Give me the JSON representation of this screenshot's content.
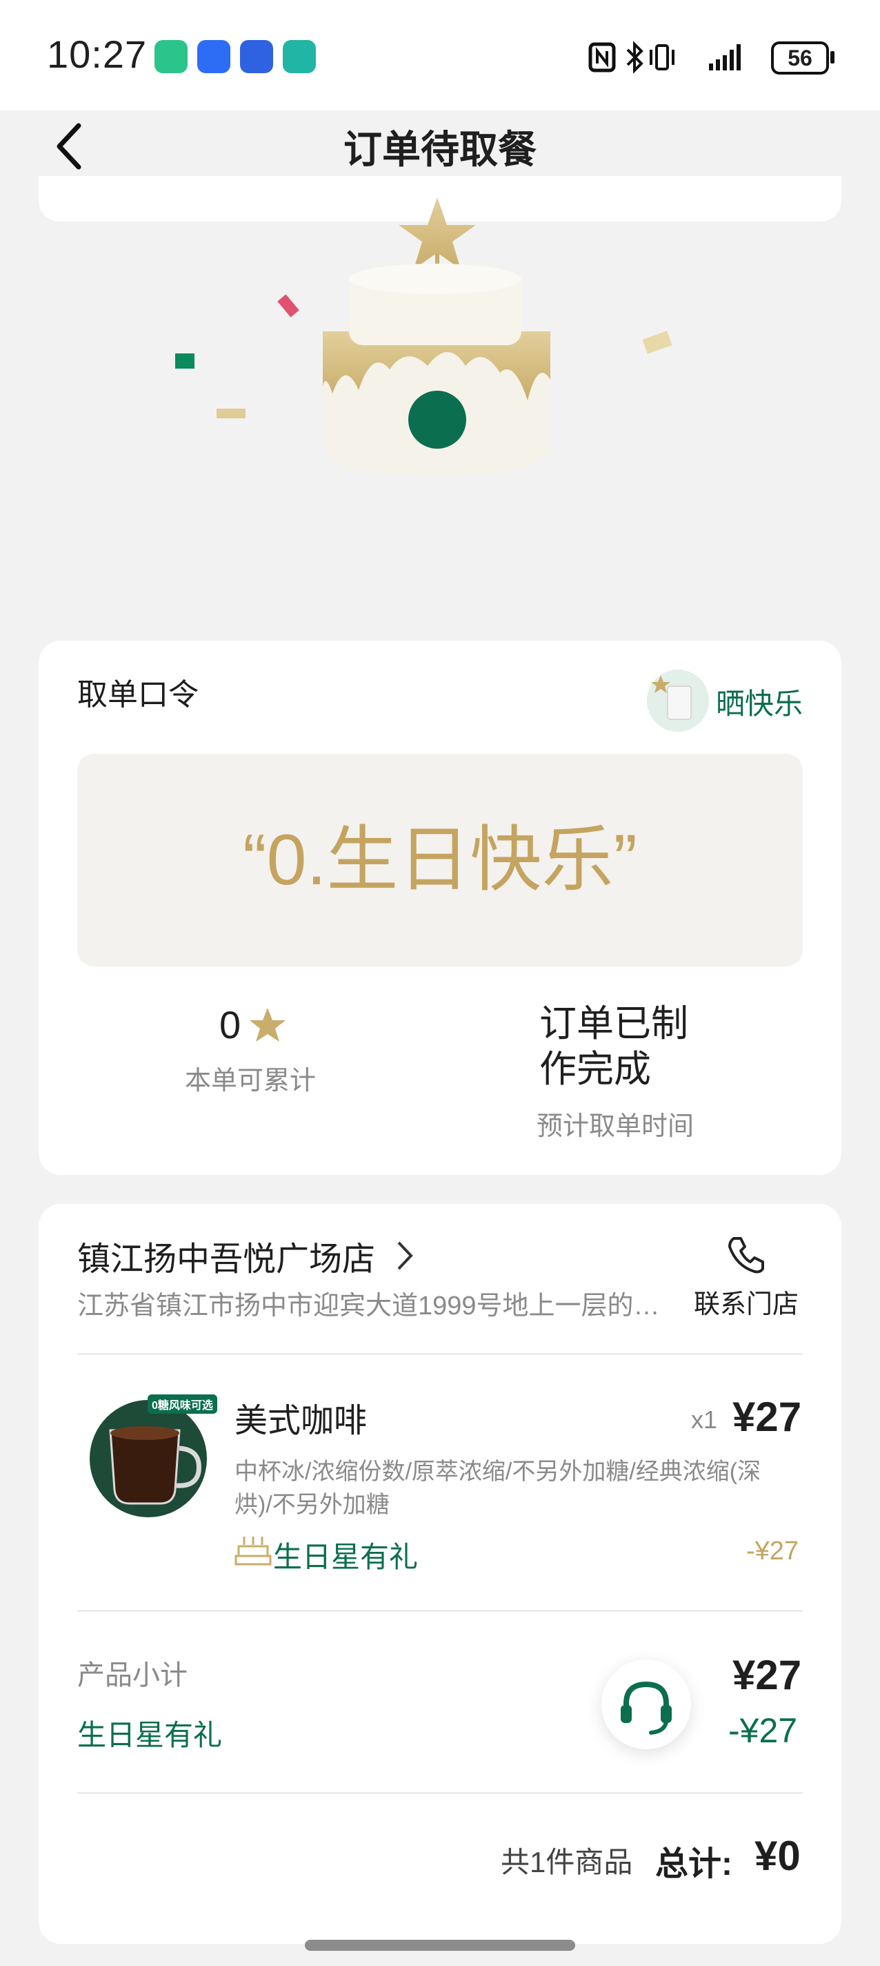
{
  "status_bar": {
    "time": "10:27",
    "battery": "56",
    "app_icons": [
      "mi-home-icon",
      "messages-icon",
      "wallet-icon",
      "link-icon"
    ]
  },
  "header": {
    "title": "订单待取餐",
    "back_icon": "chevron-left-icon"
  },
  "pickup": {
    "heading": "取单口令",
    "share_label": "晒快乐",
    "code": "“0.生日快乐”",
    "stars_value": "0",
    "stars_caption": "本单可累计",
    "status_line1": "订单已制",
    "status_line2": "作完成",
    "status_caption": "预计取单时间"
  },
  "store": {
    "name": "镇江扬中吾悦广场店",
    "address": "江苏省镇江市扬中市迎宾大道1999号地上一层的…",
    "contact_label": "联系门店"
  },
  "item": {
    "badge": "0糖风味可选",
    "name": "美式咖啡",
    "qty": "x1",
    "price": "¥27",
    "spec_line1": "中杯冰/浓缩份数/原萃浓缩/不另外加糖/经典浓缩(深",
    "spec_line2": "烘)/不另外加糖",
    "promo_label": "生日星有礼",
    "promo_discount": "-¥27"
  },
  "summary": {
    "subtotal_label": "产品小计",
    "subtotal_value": "¥27",
    "promo_label": "生日星有礼",
    "promo_value": "-¥27",
    "count_label": "共1件商品",
    "total_label": "总计:",
    "total_value": "¥0"
  },
  "colors": {
    "accent_green": "#0b6e4f",
    "gold": "#c4a460",
    "background": "#f2f2f2"
  }
}
